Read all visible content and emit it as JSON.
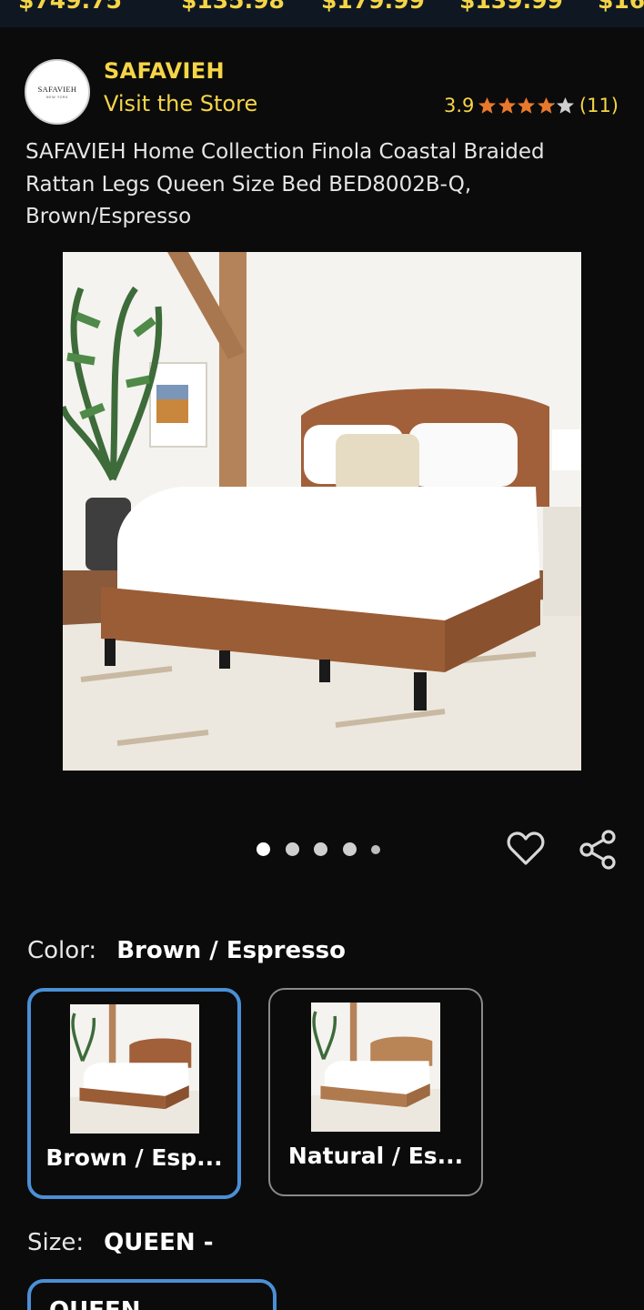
{
  "price_strip": {
    "prices": [
      "$749.75",
      "$135.98",
      "$179.99",
      "$139.99",
      "$16"
    ]
  },
  "product": {
    "brand_logo_text": "SAFAVIEH",
    "brand_logo_subtext": "NEW YORK",
    "brand_name": "SAFAVIEH",
    "visit_store": "Visit the Store",
    "rating_value": "3.9",
    "rating_stars": 3.9,
    "review_count": "(11)",
    "title": "SAFAVIEH Home Collection Finola Coastal Braided Rattan Legs Queen Size Bed BED8002B-Q, Brown/Espresso",
    "image_count": 5,
    "active_image": 1
  },
  "options": {
    "color_label": "Color:",
    "color_value": "Brown / Espresso",
    "color_swatches": [
      {
        "label": "Brown / Esp...",
        "selected": true
      },
      {
        "label": "Natural / Es...",
        "selected": false
      }
    ],
    "size_label": "Size:",
    "size_value": "QUEEN -",
    "size_chip": "QUEEN"
  },
  "colors": {
    "accent_yellow": "#f5d547",
    "star_orange": "#e8792b",
    "selected_border": "#4b8fd6",
    "background": "#0b0b0b"
  },
  "icons": {
    "heart": "heart-icon",
    "share": "share-icon"
  }
}
